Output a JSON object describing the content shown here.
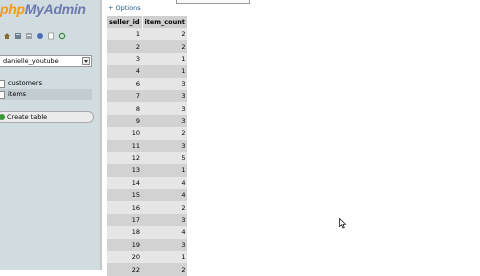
{
  "nav": {
    "logo_a": "p",
    "logo_b": "hp",
    "logo_c": "MyAdmin",
    "icons": [
      "home-icon",
      "database-icon",
      "query-icon",
      "help-icon",
      "docs-icon",
      "reload-icon"
    ],
    "db_select": "danielle_youtube",
    "tables": [
      {
        "label": "customers",
        "selected": false
      },
      {
        "label": "items",
        "selected": true
      }
    ],
    "create_table": "Create table"
  },
  "main": {
    "options_label": "+ Options",
    "columns": [
      "seller_id",
      "item_count"
    ],
    "rows": [
      [
        "1",
        "2"
      ],
      [
        "2",
        "2"
      ],
      [
        "3",
        "1"
      ],
      [
        "4",
        "1"
      ],
      [
        "6",
        "3"
      ],
      [
        "7",
        "3"
      ],
      [
        "8",
        "3"
      ],
      [
        "9",
        "3"
      ],
      [
        "10",
        "2"
      ],
      [
        "11",
        "3"
      ],
      [
        "12",
        "5"
      ],
      [
        "13",
        "1"
      ],
      [
        "14",
        "4"
      ],
      [
        "15",
        "4"
      ],
      [
        "16",
        "2"
      ],
      [
        "17",
        "3"
      ],
      [
        "18",
        "4"
      ],
      [
        "19",
        "3"
      ],
      [
        "20",
        "1"
      ],
      [
        "22",
        "2"
      ]
    ]
  },
  "colors": {
    "nav_bg": "#d0dce0",
    "header_bg": "#cfcfcf",
    "row_odd": "#e6e6e6",
    "row_even": "#d2d2d2",
    "link": "#235a81"
  }
}
